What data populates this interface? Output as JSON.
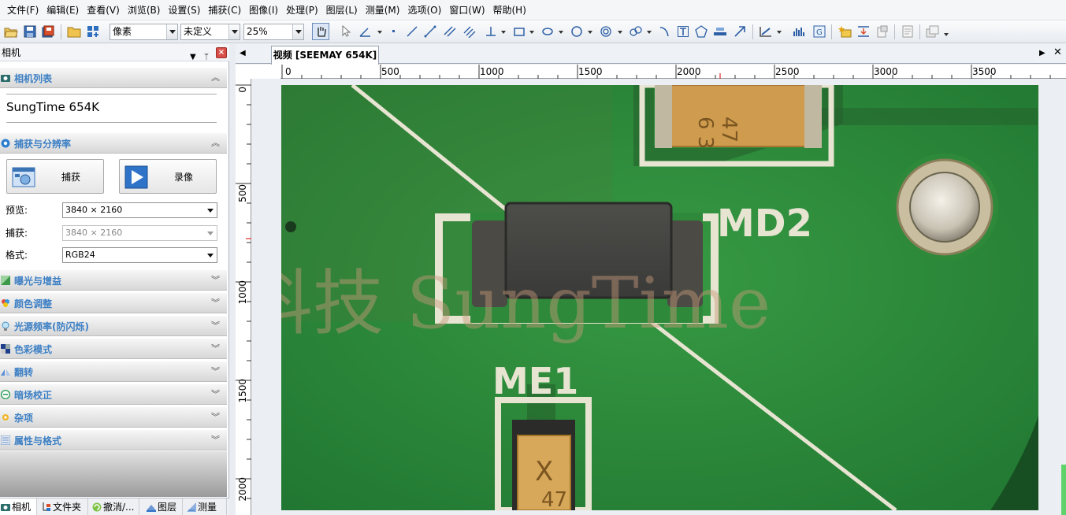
{
  "menu": [
    "文件(F)",
    "编辑(E)",
    "查看(V)",
    "浏览(B)",
    "设置(S)",
    "捕获(C)",
    "图像(I)",
    "处理(P)",
    "图层(L)",
    "测量(M)",
    "选项(O)",
    "窗口(W)",
    "帮助(H)"
  ],
  "toolbar": {
    "unit_value": "像素",
    "calibration_value": "未定义",
    "zoom_value": "25%"
  },
  "left_panel": {
    "title": "相机",
    "sections": {
      "camera_list": {
        "title": "相机列表",
        "camera_name": "SungTime 654K"
      },
      "capture": {
        "title": "捕获与分辨率",
        "snap_label": "捕获",
        "record_label": "录像",
        "preview_label": "预览:",
        "preview_value": "3840 × 2160",
        "capture_label": "捕获:",
        "capture_value": "3840 × 2160",
        "format_label": "格式:",
        "format_value": "RGB24"
      },
      "exposure": "曝光与增益",
      "color_adjust": "颜色调整",
      "light_freq": "光源频率(防闪烁)",
      "color_mode": "色彩模式",
      "flip": "翻转",
      "dark_field": "暗场校正",
      "misc": "杂项",
      "props": "属性与格式"
    },
    "bottom_tabs": [
      "相机",
      "文件夹",
      "撤消/...",
      "图层",
      "测量"
    ]
  },
  "document": {
    "tab_title": "视频 [SEEMAY 654K]",
    "ruler_h": [
      "0",
      "500",
      "1000",
      "1500",
      "2000",
      "2500",
      "3000",
      "3500"
    ],
    "ruler_v": [
      "0",
      "500",
      "1000",
      "1500",
      "2000"
    ],
    "board_labels": [
      "MD2",
      "ME1"
    ],
    "component_marks": [
      "47",
      "6 3",
      "X",
      "47"
    ],
    "watermark": "显科技 SungTime"
  },
  "colors": {
    "accent": "#3c7fc4",
    "pcb_green": "#2e8a3a",
    "silkscreen": "#e8e4d2",
    "pad_tan": "#d6a85c"
  }
}
